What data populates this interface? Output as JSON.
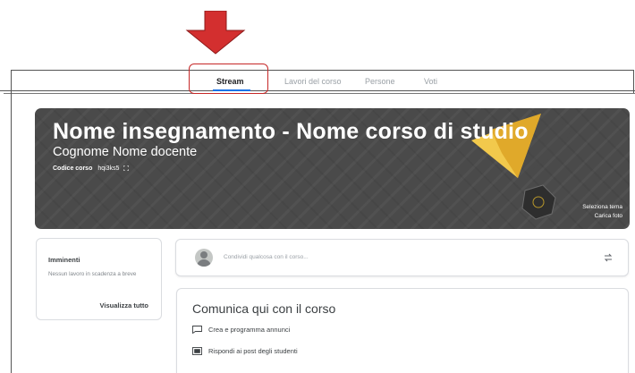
{
  "tabs": [
    {
      "label": "Stream",
      "active": true
    },
    {
      "label": "Lavori del corso",
      "active": false
    },
    {
      "label": "Persone",
      "active": false
    },
    {
      "label": "Voti",
      "active": false
    }
  ],
  "banner": {
    "title": "Nome insegnamento - Nome corso di studio",
    "teacher": "Cognome Nome docente",
    "code_label": "Codice corso",
    "code_value": "hqi3ks5",
    "select_theme": "Seleziona tema",
    "upload_photo": "Carica foto"
  },
  "upcoming": {
    "title": "Imminenti",
    "empty_text": "Nessun lavoro in scadenza a breve",
    "view_all": "Visualizza tutto"
  },
  "share": {
    "placeholder": "Condividi qualcosa con il corso..."
  },
  "communicate": {
    "title": "Comunica qui con il corso",
    "items": [
      {
        "label": "Crea e programma annunci",
        "icon": "announcement-icon"
      },
      {
        "label": "Rispondi ai post degli studenti",
        "icon": "reply-posts-icon"
      }
    ]
  },
  "colors": {
    "annotation_arrow": "#d32f2f",
    "highlight_box": "#c62828",
    "active_tab_underline": "#1a73e8",
    "banner_background": "#4a4a4a",
    "banner_accent": "#f2c94c"
  }
}
